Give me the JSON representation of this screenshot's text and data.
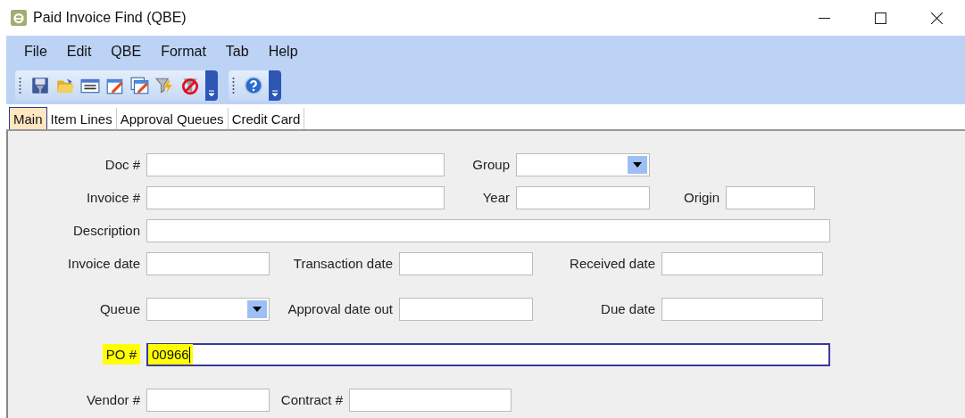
{
  "window": {
    "title": "Paid Invoice Find (QBE)"
  },
  "menu": [
    {
      "label": "File"
    },
    {
      "label": "Edit"
    },
    {
      "label": "QBE"
    },
    {
      "label": "Format"
    },
    {
      "label": "Tab"
    },
    {
      "label": "Help"
    }
  ],
  "tabs": [
    {
      "label": "Main",
      "selected": true
    },
    {
      "label": "Item Lines",
      "selected": false
    },
    {
      "label": "Approval Queues",
      "selected": false
    },
    {
      "label": "Credit Card",
      "selected": false
    }
  ],
  "form": {
    "doc": {
      "label": "Doc #"
    },
    "group": {
      "label": "Group"
    },
    "invoice": {
      "label": "Invoice #"
    },
    "year": {
      "label": "Year"
    },
    "origin": {
      "label": "Origin"
    },
    "description": {
      "label": "Description"
    },
    "invoice_date": {
      "label": "Invoice date"
    },
    "transaction_date": {
      "label": "Transaction date"
    },
    "received_date": {
      "label": "Received date"
    },
    "queue": {
      "label": "Queue"
    },
    "approval_date_out": {
      "label": "Approval date out"
    },
    "due_date": {
      "label": "Due date"
    },
    "po": {
      "label": "PO #",
      "value": "00966",
      "highlighted": true,
      "focused": true
    },
    "vendor": {
      "label": "Vendor #"
    },
    "contract": {
      "label": "Contract #"
    }
  }
}
